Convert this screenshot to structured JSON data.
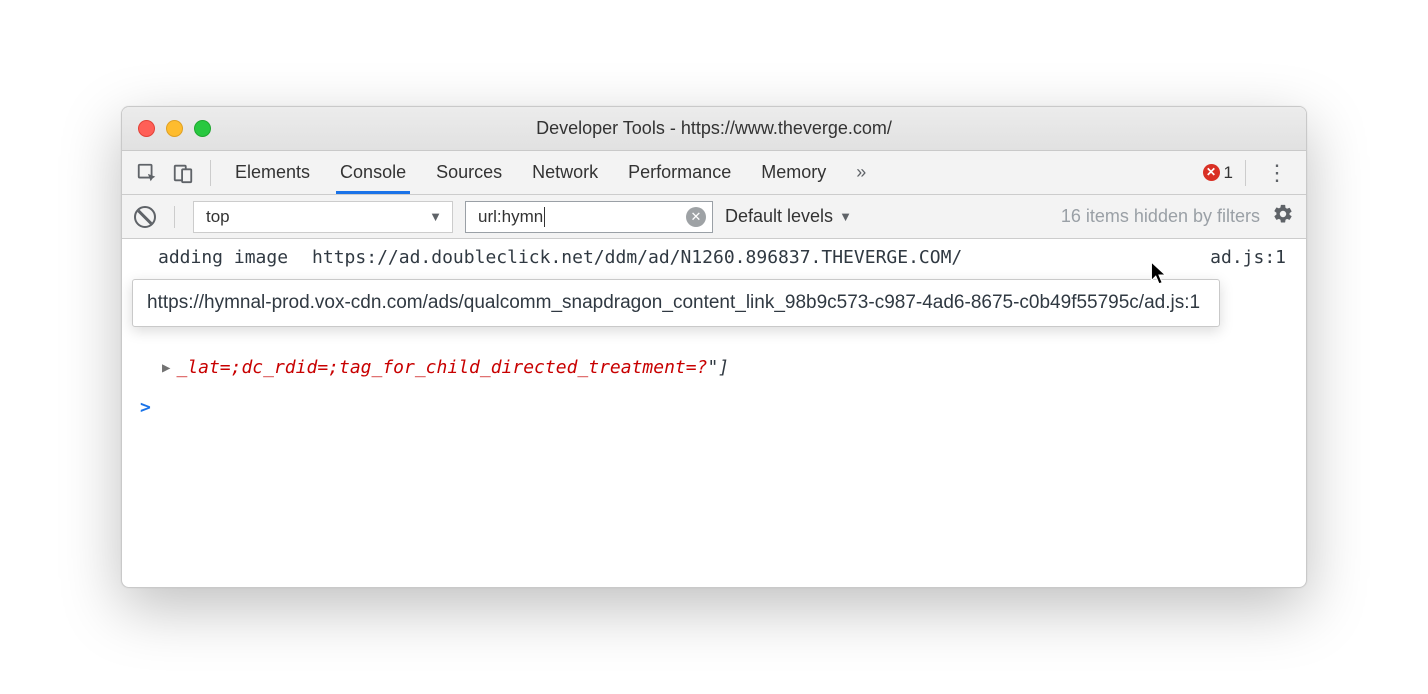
{
  "window": {
    "title": "Developer Tools - https://www.theverge.com/"
  },
  "tabs": {
    "elements": "Elements",
    "console": "Console",
    "sources": "Sources",
    "network": "Network",
    "performance": "Performance",
    "memory": "Memory"
  },
  "errors": {
    "count": "1",
    "mark": "✕"
  },
  "toolbar": {
    "context": "top",
    "filter_value": "url:hymn",
    "levels": "Default levels",
    "hidden_note": "16 items hidden by filters"
  },
  "console": {
    "line1_a": "adding image",
    "line1_b": "https://ad.doubleclick.net/ddm/ad/N1260.896837.THEVERGE.COM/",
    "line1_src": "ad.js:1",
    "tooltip": "https://hymnal-prod.vox-cdn.com/ads/qualcomm_snapdragon_content_link_98b9c573-c987-4ad6-8675-c0b49f55795c/ad.js:1",
    "line2_text": "_lat=;dc_rdid=;tag_for_child_directed_treatment=?",
    "line2_quote_close": "\"",
    "line2_bracket": "]",
    "prompt": ">"
  }
}
